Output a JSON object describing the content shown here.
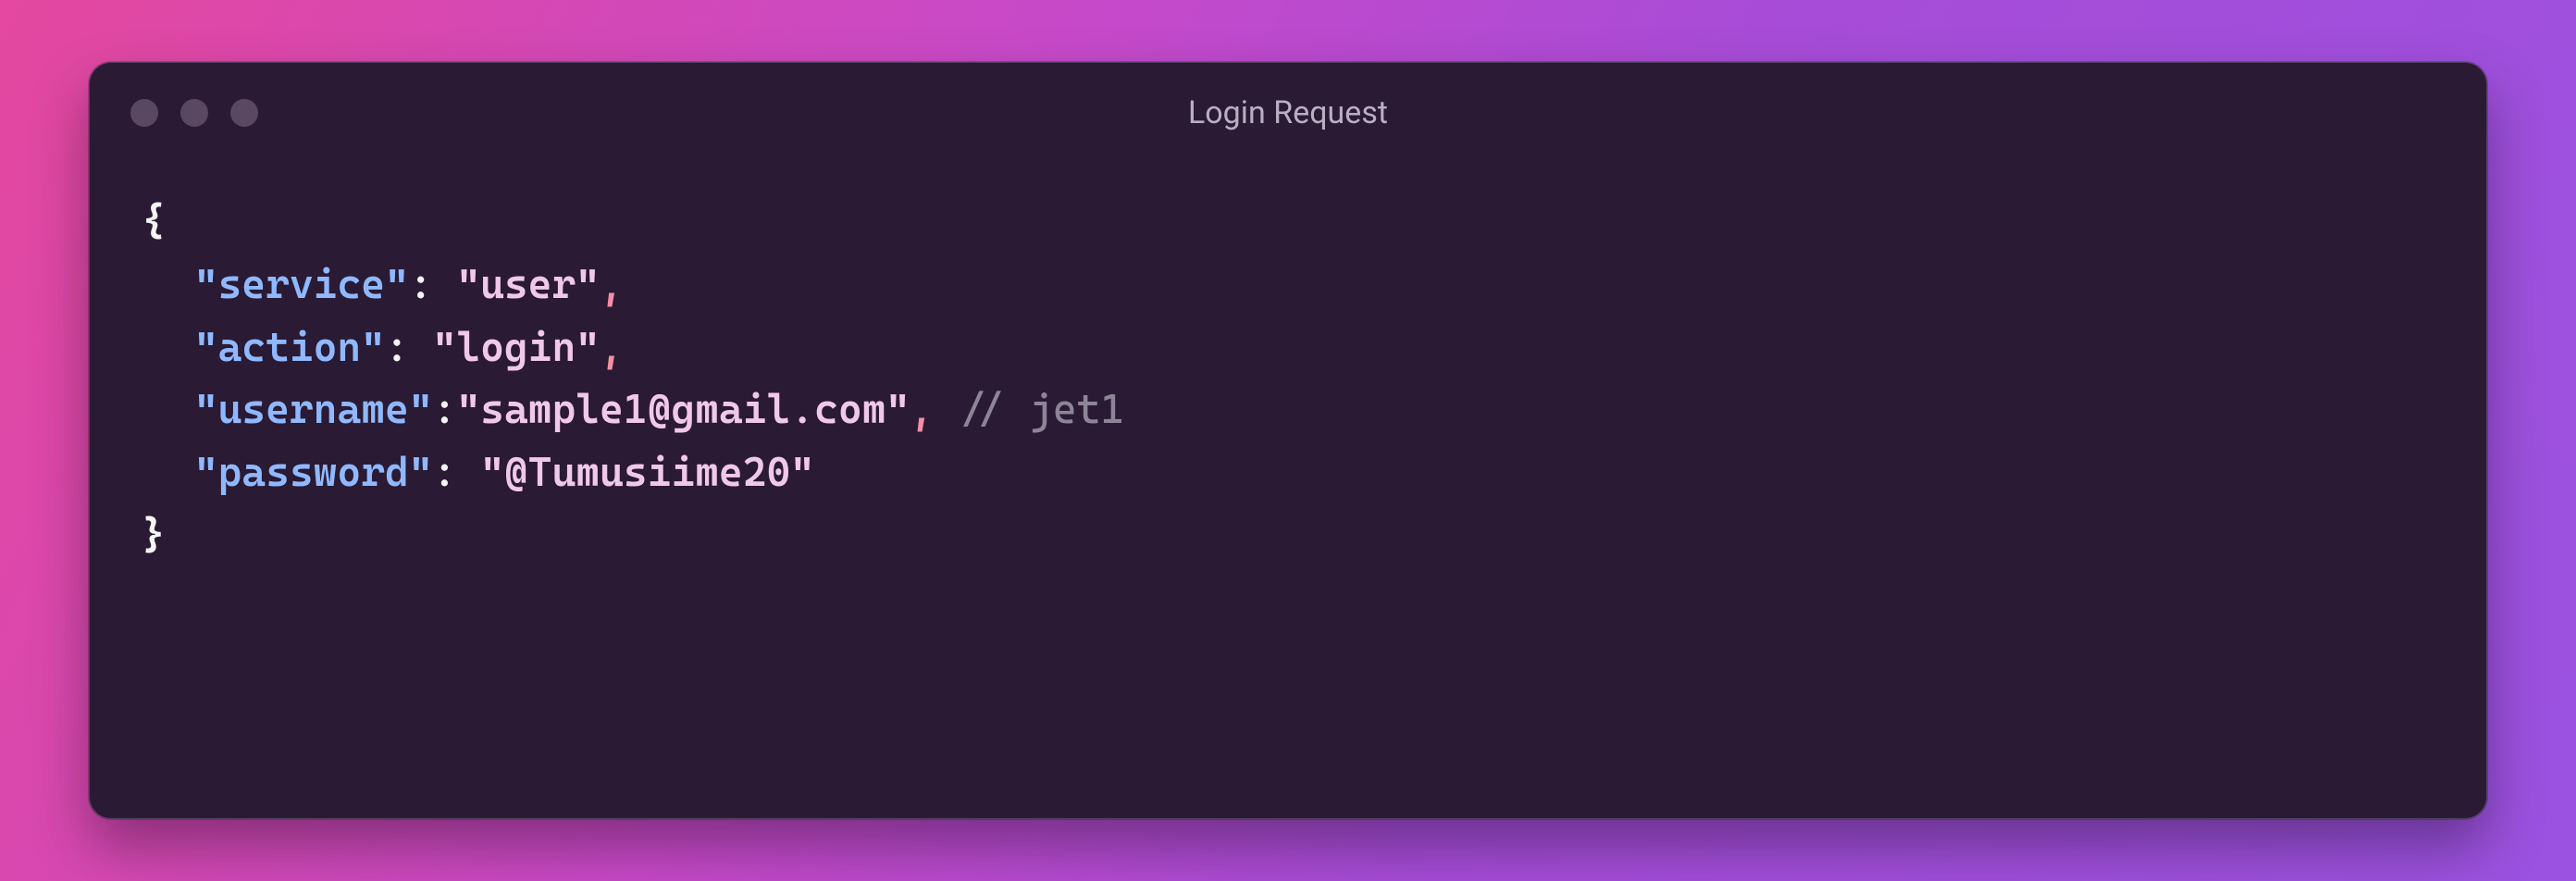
{
  "window": {
    "title": "Login Request"
  },
  "code": {
    "open_brace": "{",
    "close_brace": "}",
    "lines": [
      {
        "key": "\"service\"",
        "value": "\"user\"",
        "trailing_comma": ",",
        "comment": ""
      },
      {
        "key": "\"action\"",
        "value": "\"login\"",
        "trailing_comma": ",",
        "comment": ""
      },
      {
        "key": "\"username\"",
        "value": "\"sample1@gmail.com\"",
        "trailing_comma": ",",
        "comment": "// jet1"
      },
      {
        "key": "\"password\"",
        "value": "\"@Tumusiime20\"",
        "trailing_comma": "",
        "comment": ""
      }
    ],
    "colon": ":",
    "space": " "
  },
  "colors": {
    "background_gradient_start": "#e4489f",
    "background_gradient_end": "#9b52e0",
    "window_background": "#2a1a33",
    "key_color": "#8fb8ff",
    "string_color": "#f0c8e8",
    "comma_color": "#f48fa8",
    "comment_color": "#8d8597",
    "brace_color": "#f5f5f5"
  }
}
